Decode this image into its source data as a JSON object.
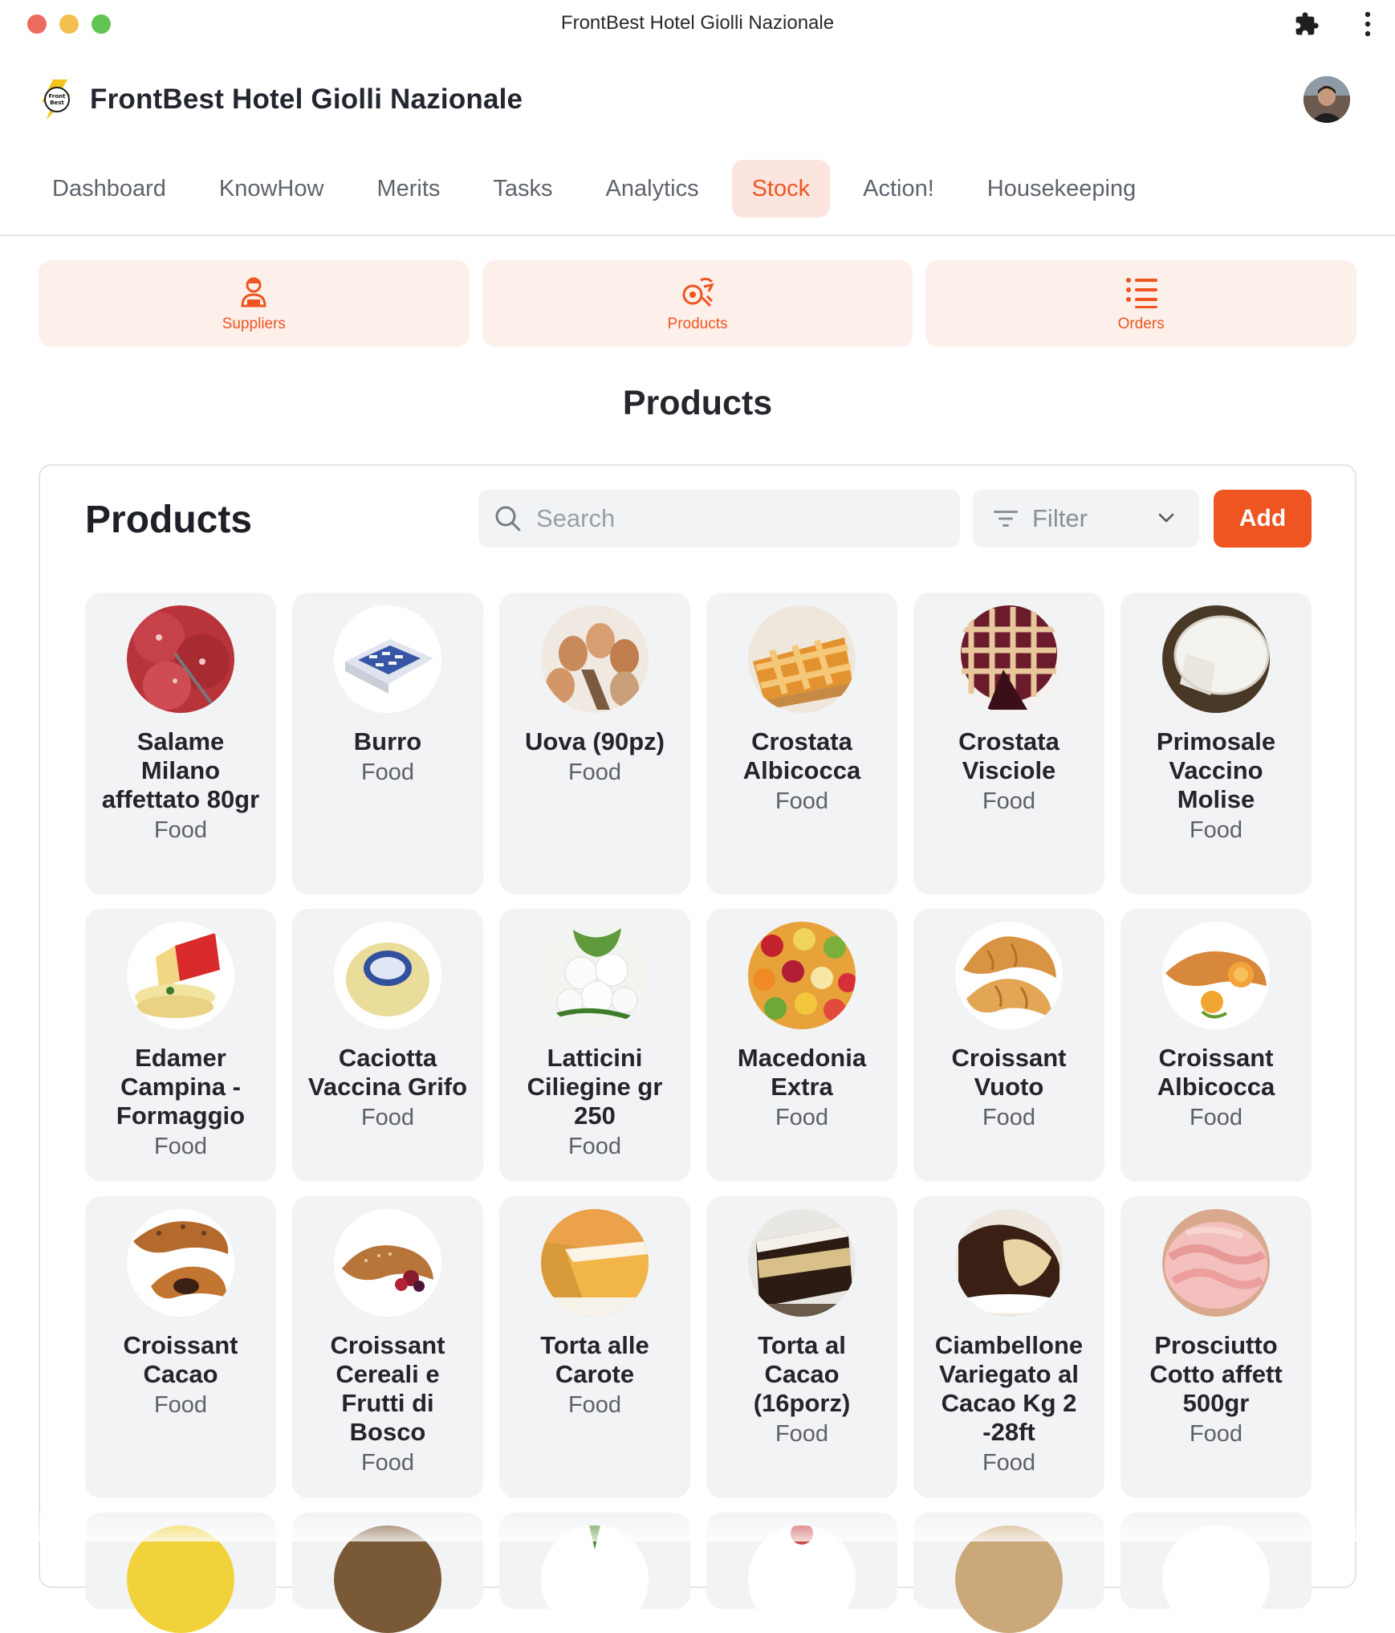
{
  "window": {
    "title": "FrontBest Hotel Giolli Nazionale"
  },
  "header": {
    "brand": "FrontBest Hotel Giolli Nazionale",
    "logo_text": "Front Best"
  },
  "tabs": [
    {
      "label": "Dashboard"
    },
    {
      "label": "KnowHow"
    },
    {
      "label": "Merits"
    },
    {
      "label": "Tasks"
    },
    {
      "label": "Analytics"
    },
    {
      "label": "Stock",
      "active": true
    },
    {
      "label": "Action!"
    },
    {
      "label": "Housekeeping"
    }
  ],
  "subnav": [
    {
      "label": "Suppliers",
      "icon": "supplier-person-icon"
    },
    {
      "label": "Products",
      "icon": "products-food-icon"
    },
    {
      "label": "Orders",
      "icon": "list-icon"
    }
  ],
  "page": {
    "heading": "Products"
  },
  "panel": {
    "title": "Products",
    "search_placeholder": "Search",
    "filter_label": "Filter",
    "add_label": "Add"
  },
  "colors": {
    "accent": "#ee5521",
    "accent_soft": "#fde5df",
    "card_bg": "#f2f3f5"
  },
  "products": [
    {
      "name": "Salame Milano affettato 80gr",
      "category": "Food"
    },
    {
      "name": "Burro",
      "category": "Food"
    },
    {
      "name": "Uova (90pz)",
      "category": "Food"
    },
    {
      "name": "Crostata Albicocca",
      "category": "Food"
    },
    {
      "name": "Crostata Visciole",
      "category": "Food"
    },
    {
      "name": "Primosale Vaccino Molise",
      "category": "Food"
    },
    {
      "name": "Edamer Campina - Formaggio",
      "category": "Food"
    },
    {
      "name": "Caciotta Vaccina Grifo",
      "category": "Food"
    },
    {
      "name": "Latticini Ciliegine gr 250",
      "category": "Food"
    },
    {
      "name": "Macedonia Extra",
      "category": "Food"
    },
    {
      "name": "Croissant Vuoto",
      "category": "Food"
    },
    {
      "name": "Croissant Albicocca",
      "category": "Food"
    },
    {
      "name": "Croissant Cacao",
      "category": "Food"
    },
    {
      "name": "Croissant Cereali e Frutti di Bosco",
      "category": "Food"
    },
    {
      "name": "Torta alle Carote",
      "category": "Food"
    },
    {
      "name": "Torta al Cacao (16porz)",
      "category": "Food"
    },
    {
      "name": "Ciambellone Variegato al Cacao Kg 2 -28ft",
      "category": "Food"
    },
    {
      "name": "Prosciutto Cotto affett 500gr",
      "category": "Food"
    }
  ]
}
